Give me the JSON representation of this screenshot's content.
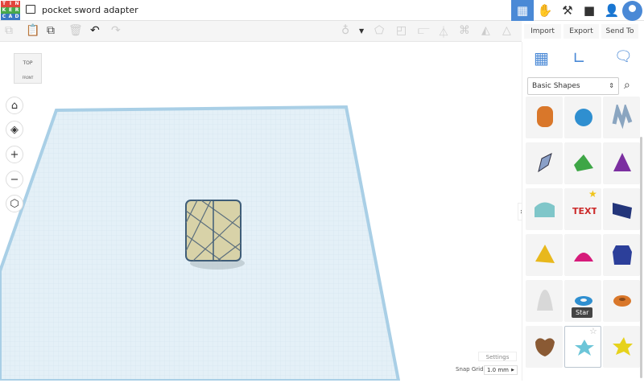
{
  "app": {
    "logo_letters": [
      "T",
      "I",
      "N",
      "K",
      "E",
      "R",
      "C",
      "A",
      "D"
    ],
    "title": "pocket sword adapter"
  },
  "header_icons": [
    "grid-view-icon",
    "sim-lab-icon",
    "minecraft-pickaxe-icon",
    "bricks-icon",
    "add-user-icon",
    "avatar-icon"
  ],
  "toolbar": {
    "import": "Import",
    "export": "Export",
    "send_to": "Send To"
  },
  "viewcube": {
    "top": "TOP",
    "front": "FRONT"
  },
  "panel": {
    "category": "Basic Shapes",
    "tooltip": "Star"
  },
  "footer": {
    "settings": "Settings",
    "snap_label": "Snap Grid",
    "snap_value": "1.0 mm"
  },
  "colors": {
    "accent": "#4a89d6",
    "plane": "#e4f0f7"
  }
}
